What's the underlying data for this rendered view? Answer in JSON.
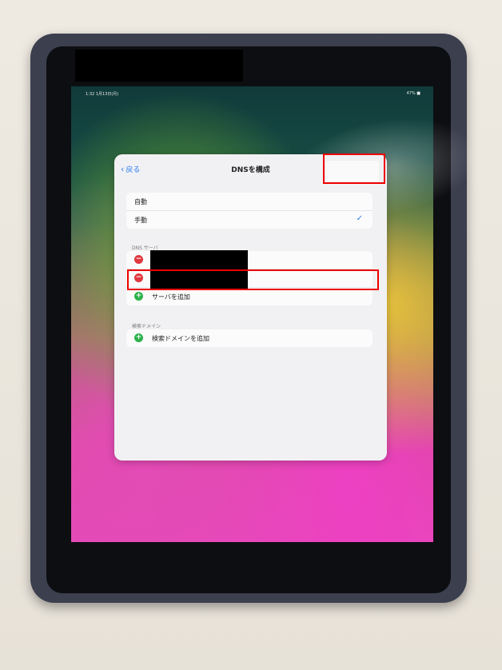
{
  "status_bar": {
    "time": "1:32  1月13日(月)",
    "battery": "47% ■"
  },
  "nav": {
    "back_label": "戻る",
    "title": "DNSを構成"
  },
  "config_mode": {
    "options": [
      {
        "label": "自動",
        "selected": false
      },
      {
        "label": "手動",
        "selected": true
      }
    ],
    "check_icon": "checkmark-icon"
  },
  "dns_servers": {
    "header": "DNS サーバ",
    "add_label": "サーバを追加"
  },
  "search_domains": {
    "header": "検索ドメイン",
    "add_label": "検索ドメインを追加"
  },
  "colors": {
    "accent": "#2a7bf0",
    "delete": "#e0383e",
    "add": "#2db24c",
    "annotation": "#ee0000",
    "case": "#3c3f4e",
    "pencil": "#ef5a1d"
  }
}
